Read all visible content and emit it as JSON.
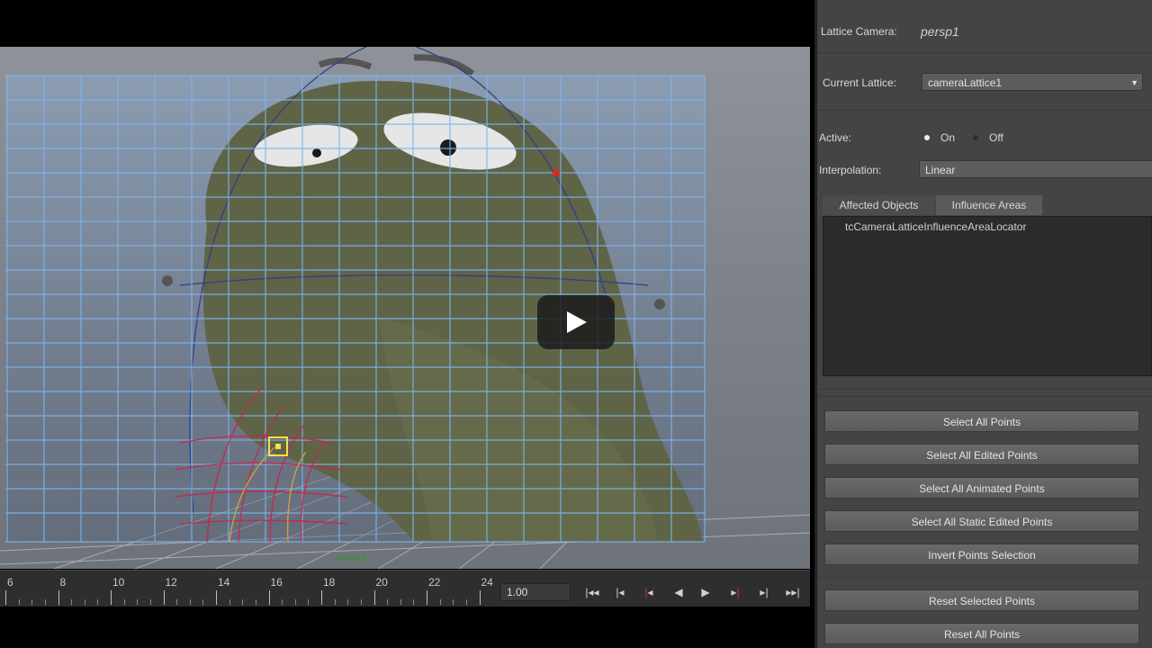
{
  "viewport": {
    "camera_label": "persp1"
  },
  "timeline": {
    "tick_labels": [
      "6",
      "8",
      "10",
      "12",
      "14",
      "16",
      "18",
      "20",
      "22",
      "24"
    ],
    "current_frame": "1.00",
    "controls": [
      "go-to-start",
      "step-back-key",
      "step-back-frame",
      "play-back",
      "play-forward",
      "step-forward-frame",
      "step-forward-key",
      "go-to-end"
    ]
  },
  "panel": {
    "lattice_camera_label": "Lattice Camera:",
    "lattice_camera_value": "persp1",
    "current_lattice_label": "Current Lattice:",
    "current_lattice_value": "cameraLattice1",
    "active_label": "Active:",
    "active_on": "On",
    "active_off": "Off",
    "interpolation_label": "Interpolation:",
    "interpolation_value": "Linear",
    "tabs": [
      "Affected Objects",
      "Influence Areas"
    ],
    "list_items": [
      "tcCameraLatticeInfluenceAreaLocator"
    ],
    "buttons": [
      "Select All Points",
      "Select All Edited Points",
      "Select All Animated Points",
      "Select All Static Edited Points",
      "Invert Points Selection"
    ],
    "buttons2": [
      "Reset Selected Points",
      "Reset All Points"
    ]
  },
  "colors": {
    "lattice": "#7fb4ec",
    "lattice_deformed": "#c8264a",
    "character": "#5e6346",
    "accent_green": "#3f8e3c"
  }
}
